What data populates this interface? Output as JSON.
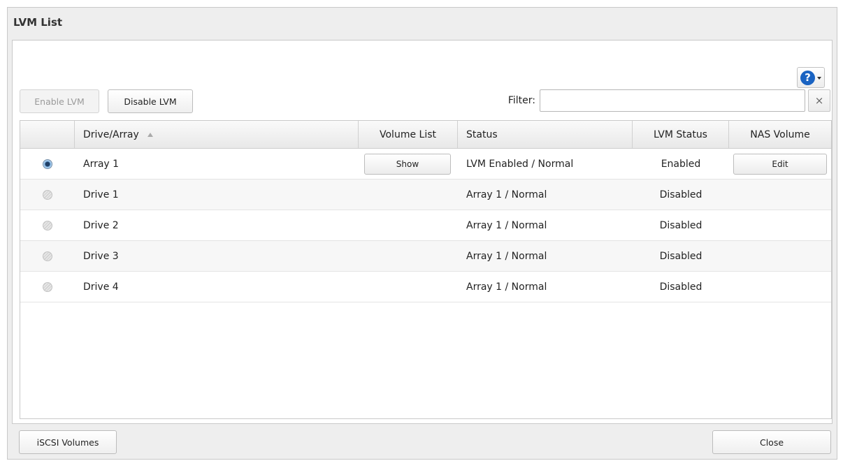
{
  "dialog": {
    "title": "LVM List"
  },
  "toolbar": {
    "help_icon": "question-circle-icon",
    "enable_lvm_label": "Enable LVM",
    "disable_lvm_label": "Disable LVM",
    "filter_label": "Filter:",
    "filter_value": "",
    "filter_placeholder": "",
    "clear_icon": "×"
  },
  "table": {
    "columns": {
      "drive_array": "Drive/Array",
      "volume_list": "Volume List",
      "status": "Status",
      "lvm_status": "LVM Status",
      "nas_volume": "NAS Volume"
    },
    "sort": {
      "column": "drive_array",
      "direction": "ascending"
    },
    "rows": [
      {
        "selected": true,
        "name": "Array 1",
        "volume_list_button": "Show",
        "status": "LVM Enabled / Normal",
        "lvm_status": "Enabled",
        "nas_volume_button": "Edit"
      },
      {
        "selected": false,
        "name": "Drive 1",
        "status": "Array 1 / Normal",
        "lvm_status": "Disabled"
      },
      {
        "selected": false,
        "name": "Drive 2",
        "status": "Array 1 / Normal",
        "lvm_status": "Disabled"
      },
      {
        "selected": false,
        "name": "Drive 3",
        "status": "Array 1 / Normal",
        "lvm_status": "Disabled"
      },
      {
        "selected": false,
        "name": "Drive 4",
        "status": "Array 1 / Normal",
        "lvm_status": "Disabled"
      }
    ]
  },
  "footer": {
    "iscsi_volumes_label": "iSCSI Volumes",
    "close_label": "Close"
  }
}
